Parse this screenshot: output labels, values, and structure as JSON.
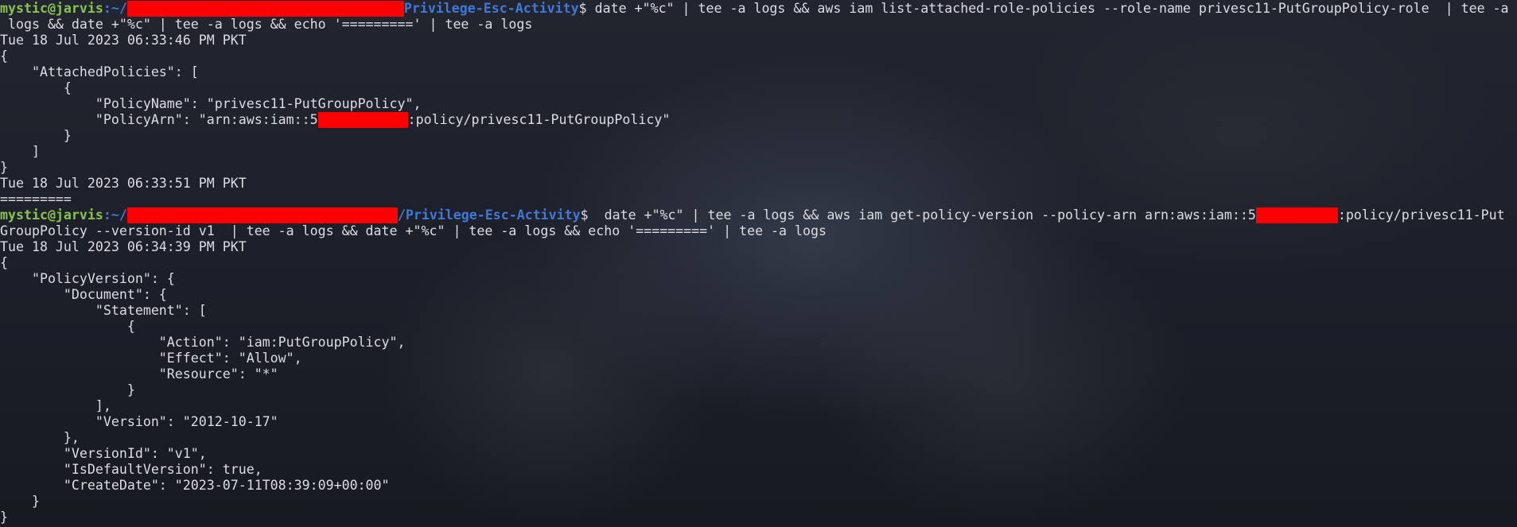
{
  "prompt": {
    "user_host": "mystic@jarvis",
    "path_prefix": ":~/",
    "folder_1": "Privilege-Esc-Activity",
    "folder_2": "/Privilege-Esc-Activity",
    "symbol": "$"
  },
  "command1": {
    "line1": " date +\"%c\" | tee -a logs && aws iam list-attached-role-policies --role-name privesc11-PutGroupPolicy-role  | tee -a",
    "line2": " logs && date +\"%c\" | tee -a logs && echo '=========' | tee -a logs"
  },
  "output1": {
    "timestamp_start": "Tue 18 Jul 2023 06:33:46 PM PKT",
    "open_brace": "{",
    "attached_policies_key": "    \"AttachedPolicies\": [",
    "item_open": "        {",
    "policy_name_line": "            \"PolicyName\": \"privesc11-PutGroupPolicy\",",
    "policy_arn_prefix": "            \"PolicyArn\": \"arn:aws:iam::5",
    "policy_arn_suffix": ":policy/privesc11-PutGroupPolicy\"",
    "item_close": "        }",
    "array_close": "    ]",
    "close_brace": "}",
    "timestamp_end": "Tue 18 Jul 2023 06:33:51 PM PKT",
    "separator": "========="
  },
  "command2": {
    "line1_prefix": "  date +\"%c\" | tee -a logs && aws iam get-policy-version --policy-arn arn:aws:iam::5",
    "line1_suffix": ":policy/privesc11-Put",
    "line2": "GroupPolicy --version-id v1  | tee -a logs && date +\"%c\" | tee -a logs && echo '=========' | tee -a logs"
  },
  "output2": {
    "timestamp_start": "Tue 18 Jul 2023 06:34:39 PM PKT",
    "lines": [
      "{",
      "    \"PolicyVersion\": {",
      "        \"Document\": {",
      "            \"Statement\": [",
      "                {",
      "                    \"Action\": \"iam:PutGroupPolicy\",",
      "                    \"Effect\": \"Allow\",",
      "                    \"Resource\": \"*\"",
      "                }",
      "            ],",
      "            \"Version\": \"2012-10-17\"",
      "        },",
      "        \"VersionId\": \"v1\",",
      "        \"IsDefaultVersion\": true,",
      "        \"CreateDate\": \"2023-07-11T08:39:09+00:00\"",
      "    }",
      "}"
    ]
  },
  "colors": {
    "background": "#1b1d27",
    "prompt_user": "#88c24f",
    "prompt_path": "#3f78d6",
    "text": "#dcdde3",
    "redaction": "#ff0000"
  }
}
